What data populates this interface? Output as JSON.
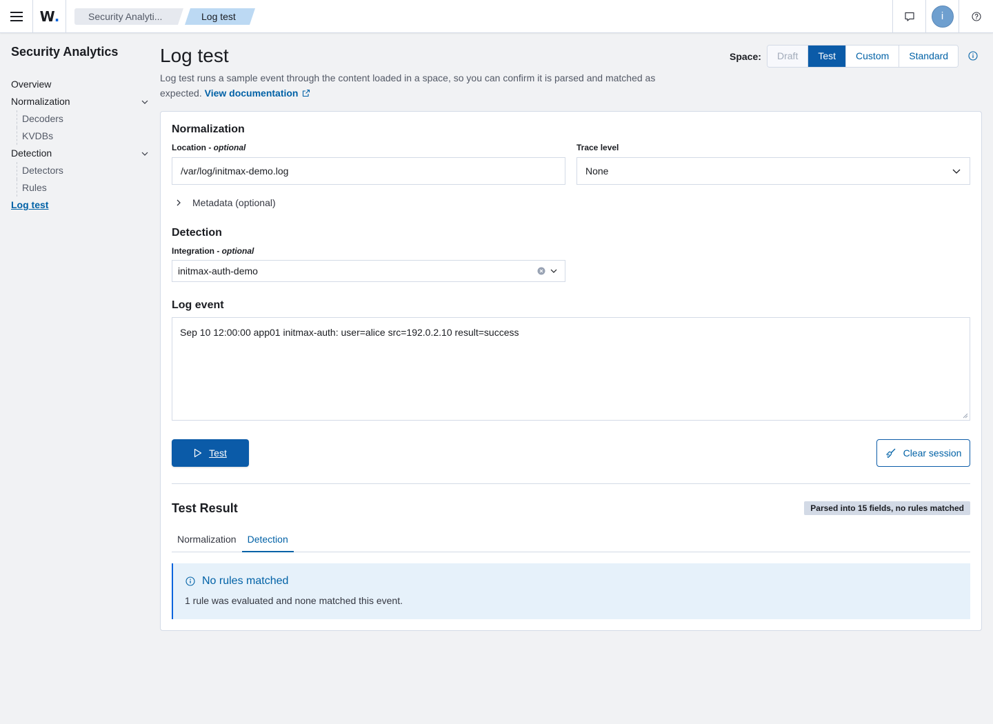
{
  "topbar": {
    "logo": "W",
    "breadcrumbs": [
      "Security Analyti...",
      "Log test"
    ],
    "avatar_initial": "i"
  },
  "sidebar": {
    "title": "Security Analytics",
    "items": [
      {
        "label": "Overview"
      },
      {
        "label": "Normalization",
        "children": [
          "Decoders",
          "KVDBs"
        ]
      },
      {
        "label": "Detection",
        "children": [
          "Detectors",
          "Rules"
        ]
      },
      {
        "label": "Log test",
        "active": true
      }
    ]
  },
  "page": {
    "title": "Log test",
    "description": "Log test runs a sample event through the content loaded in a space, so you can confirm it is parsed and matched as expected.",
    "doc_link": "View documentation"
  },
  "space": {
    "label": "Space:",
    "options": [
      "Draft",
      "Test",
      "Custom",
      "Standard"
    ],
    "selected": "Test",
    "disabled": [
      "Draft"
    ]
  },
  "normalization": {
    "title": "Normalization",
    "location_label": "Location - ",
    "location_optional": "optional",
    "location_value": "/var/log/initmax-demo.log",
    "trace_label": "Trace level",
    "trace_value": "None",
    "metadata_toggle": "Metadata (optional)"
  },
  "detection": {
    "title": "Detection",
    "integration_label": "Integration - ",
    "integration_optional": "optional",
    "integration_value": "initmax-auth-demo"
  },
  "log_event": {
    "title": "Log event",
    "value": "Sep 10 12:00:00 app01 initmax-auth: user=alice src=192.0.2.10 result=success"
  },
  "actions": {
    "test_label": "Test",
    "clear_label": "Clear session"
  },
  "result": {
    "title": "Test Result",
    "badge": "Parsed into 15 fields, no rules matched",
    "tabs": [
      "Normalization",
      "Detection"
    ],
    "active_tab": "Detection",
    "callout_title": "No rules matched",
    "callout_body": "1 rule was evaluated and none matched this event."
  },
  "colors": {
    "primary": "#0b5ba8",
    "link": "#0061a6",
    "callout_bg": "#e6f1fa"
  }
}
